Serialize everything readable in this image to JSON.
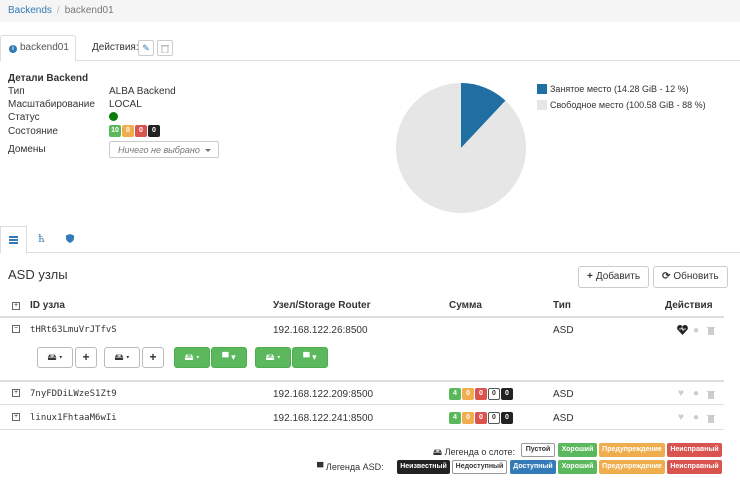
{
  "breadcrumb": {
    "root": "Backends",
    "separator": "/",
    "current": "backend01"
  },
  "tabs": {
    "active_label": "backend01",
    "actions_label": "Действия:"
  },
  "details": {
    "title": "Детали Backend",
    "rows": [
      {
        "label": "Тип",
        "value": "ALBA Backend"
      },
      {
        "label": "Масштабирование",
        "value": "LOCAL"
      },
      {
        "label": "Статус",
        "value": ""
      },
      {
        "label": "Состояние",
        "value": ""
      },
      {
        "label": "Домены",
        "value": ""
      }
    ],
    "state_counts": [
      "10",
      "0",
      "0",
      "0"
    ],
    "domains_placeholder": "Ничего не выбрано"
  },
  "chart_data": {
    "type": "pie",
    "slices": [
      {
        "label": "Занятое место (14.28 GiB - 12 %)",
        "value": 12,
        "color": "#1f6fa3"
      },
      {
        "label": "Свободное место (100.58 GiB - 88 %)",
        "value": 88,
        "color": "#e6e6e6"
      }
    ],
    "legend_position": "right"
  },
  "asd": {
    "title": "ASD узлы",
    "add_label": "Добавить",
    "refresh_label": "Обновить",
    "columns": [
      "ID узла",
      "Узел/Storage Router",
      "Сумма",
      "Тип",
      "Действия"
    ],
    "rows": [
      {
        "id": "tHRt63LmuVrJTfvS",
        "router": "192.168.122.26:8500",
        "counts": [],
        "type": "ASD",
        "expanded": true
      },
      {
        "id": "7nyFDDiLWzeS1Zt9",
        "router": "192.168.122.209:8500",
        "counts": [
          "4",
          "0",
          "0",
          "0",
          "0"
        ],
        "type": "ASD",
        "expanded": false
      },
      {
        "id": "linux1FhtaaM6wIi",
        "router": "192.168.122.241:8500",
        "counts": [
          "4",
          "0",
          "0",
          "0",
          "0"
        ],
        "type": "ASD",
        "expanded": false
      }
    ]
  },
  "legend": {
    "slot_label": "Легенда о слоте:",
    "slot_items": [
      "Пустой",
      "Хороший",
      "Предупреждение",
      "Неисправный"
    ],
    "asd_label": "Легенда ASD:",
    "asd_items": [
      "Неизвестный",
      "Недоступный",
      "Доступный",
      "Хороший",
      "Предупреждение",
      "Неисправный"
    ]
  },
  "colors": {
    "link": "#337ab7",
    "green": "#5cb85c",
    "orange": "#f0ad4e",
    "red": "#d9534f",
    "dark": "#222222",
    "blue": "#337ab7"
  }
}
